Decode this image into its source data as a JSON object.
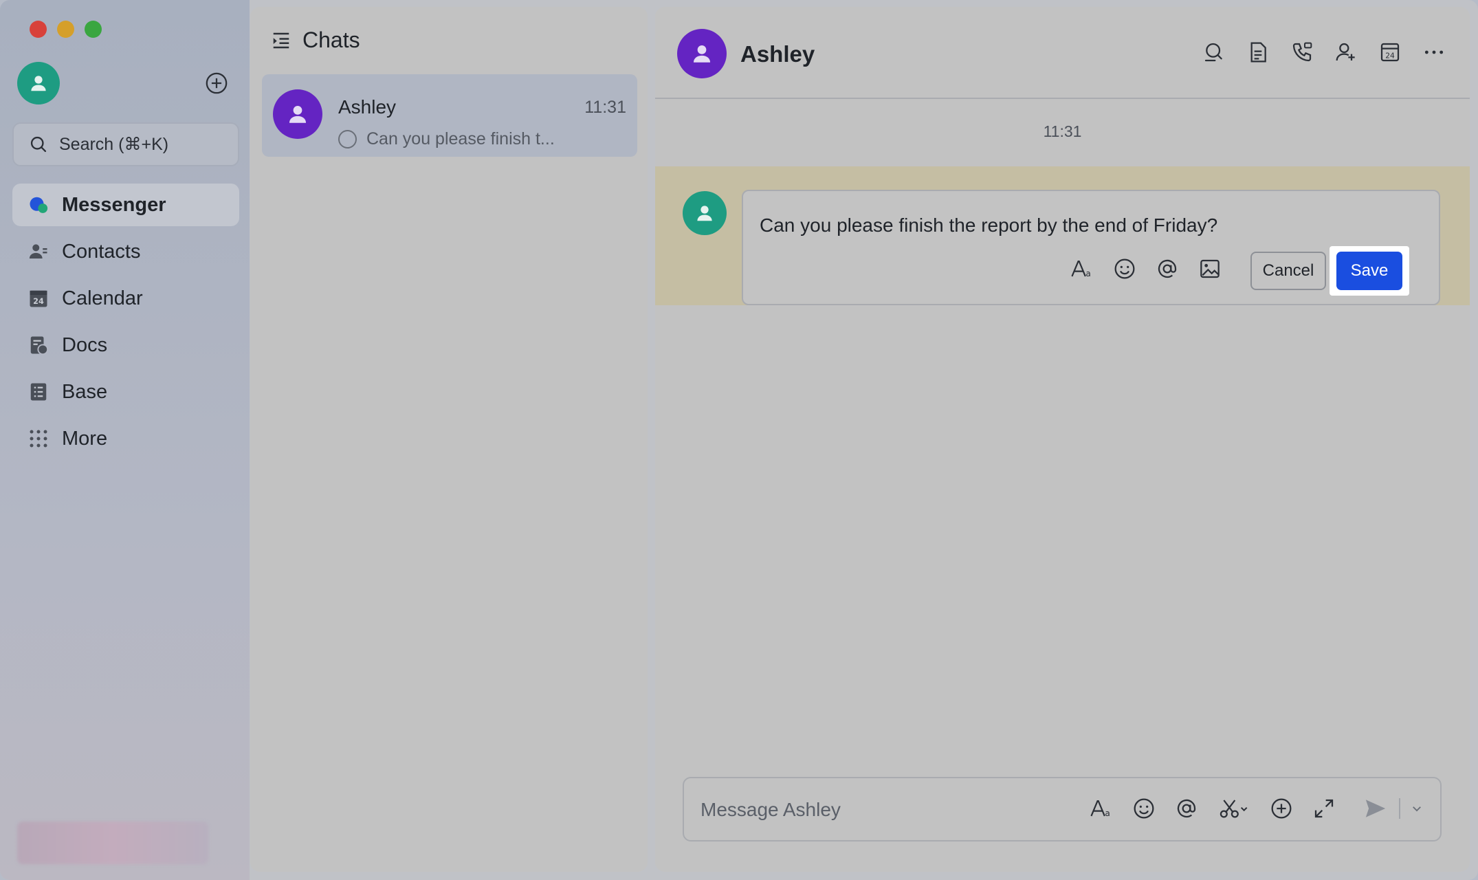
{
  "nav": {
    "search_placeholder": "Search (⌘+K)",
    "items": [
      {
        "label": "Messenger",
        "icon": "messenger-icon",
        "active": true
      },
      {
        "label": "Contacts",
        "icon": "contacts-icon"
      },
      {
        "label": "Calendar",
        "icon": "calendar-icon"
      },
      {
        "label": "Docs",
        "icon": "docs-icon"
      },
      {
        "label": "Base",
        "icon": "base-icon"
      },
      {
        "label": "More",
        "icon": "grid-icon"
      }
    ]
  },
  "chat_list": {
    "title": "Chats",
    "chats": [
      {
        "name": "Ashley",
        "time": "11:31",
        "preview": "Can you please finish t..."
      }
    ]
  },
  "conversation": {
    "name": "Ashley",
    "time_separator": "11:31",
    "editing_message": "Can you please finish the report by the end of Friday?",
    "cancel_label": "Cancel",
    "save_label": "Save",
    "composer_placeholder": "Message Ashley"
  },
  "colors": {
    "accent": "#1a4ee0",
    "avatar_purple": "#6424c2",
    "avatar_green": "#1e9c82",
    "highlight": "#c5bea3"
  }
}
